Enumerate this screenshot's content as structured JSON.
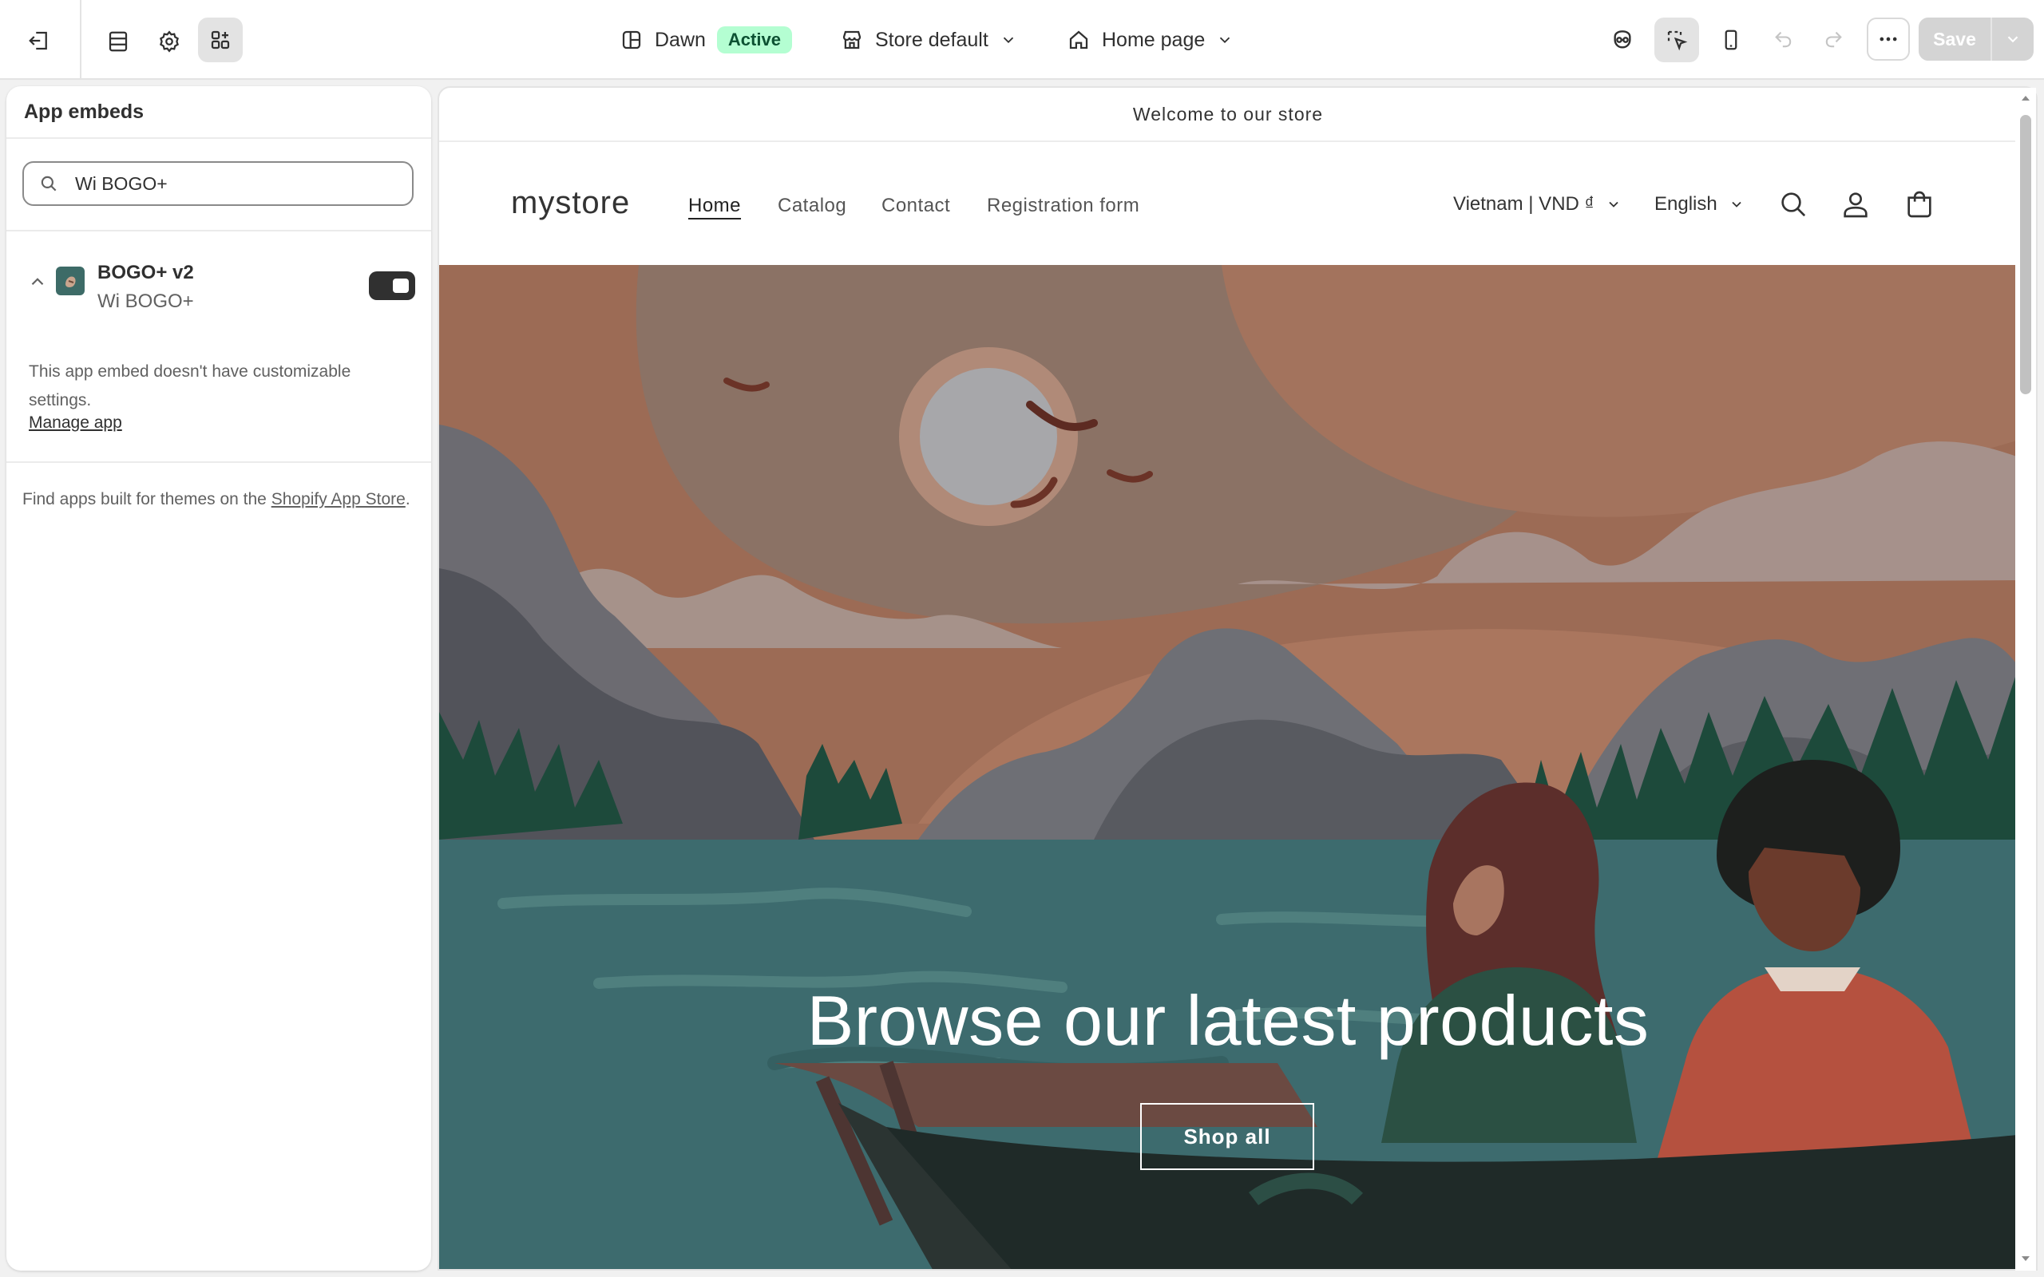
{
  "topbar": {
    "theme_name": "Dawn",
    "theme_status": "Active",
    "store_selector": "Store default",
    "page_selector": "Home page",
    "save_label": "Save"
  },
  "panel": {
    "title": "App embeds",
    "search_value": "Wi BOGO+",
    "embed": {
      "name": "BOGO+ v2",
      "provider": "Wi BOGO+",
      "enabled": true,
      "note": "This app embed doesn't have customizable settings.",
      "manage_link": "Manage app"
    },
    "footer_text": "Find apps built for themes on the ",
    "footer_link": "Shopify App Store",
    "footer_suffix": "."
  },
  "preview": {
    "announcement": "Welcome to our store",
    "logo": "mystore",
    "nav": [
      "Home",
      "Catalog",
      "Contact",
      "Registration form"
    ],
    "active_nav": "Home",
    "currency": "Vietnam | VND ₫",
    "language": "English",
    "hero_heading": "Browse our latest products",
    "hero_button": "Shop all"
  },
  "colors": {
    "accent_active_bg": "#b4fed2",
    "toggle_on": "#303030",
    "hero_sky": "#a06e58",
    "hero_water": "#3d6b6e"
  }
}
